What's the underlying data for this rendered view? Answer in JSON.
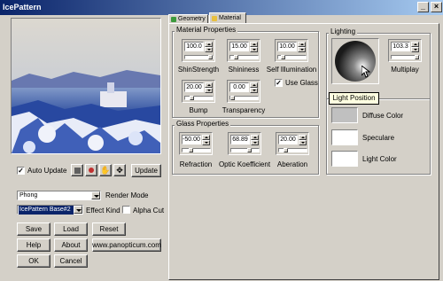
{
  "window": {
    "title": "IcePattern",
    "min_icon": "minimize-icon",
    "close_icon": "close-icon"
  },
  "preview": {
    "description_icon": "landscape-preview"
  },
  "auto_update": {
    "label": "Auto Update",
    "checked": true
  },
  "tools": {
    "icons": [
      "render-square-icon",
      "record-dot-icon",
      "hand-pan-icon",
      "move-arrows-icon"
    ],
    "update_label": "Update"
  },
  "render_mode": {
    "value": "Phong",
    "label": "Render Mode"
  },
  "effect_kind": {
    "value": "IcePattern Base#2",
    "label": "Effect Kind"
  },
  "alpha_cut": {
    "label": "Alpha Cut",
    "checked": false
  },
  "buttons": {
    "save": "Save",
    "load": "Load",
    "reset": "Reset",
    "help": "Help",
    "about": "About",
    "website": "www.panopticum.com",
    "ok": "OK",
    "cancel": "Cancel"
  },
  "tabs": [
    {
      "label": "Geometry",
      "active": false
    },
    {
      "label": "Material",
      "active": true
    }
  ],
  "material": {
    "title": "Material Properties",
    "shin_strength": {
      "value": "100.0",
      "label": "ShinStrength",
      "level": 1.0
    },
    "shininess": {
      "value": "15.00",
      "label": "Shininess",
      "level": 0.15
    },
    "self_illum": {
      "value": "10.00",
      "label": "Self Illumination",
      "level": 0.1
    },
    "bump": {
      "value": "20.00",
      "label": "Bump",
      "level": 0.2
    },
    "transparency": {
      "value": "0.00",
      "label": "Transparency",
      "level": 0.0
    },
    "use_glass": {
      "label": "Use Glass",
      "checked": true
    }
  },
  "glass": {
    "title": "Glass Properties",
    "refraction": {
      "value": "-50.00",
      "label": "Refraction",
      "level": 0.25
    },
    "optic_koef": {
      "value": "68.89",
      "label": "Optic Koefficient",
      "level": 0.69
    },
    "aberration": {
      "value": "20.00",
      "label": "Aberation",
      "level": 0.2
    }
  },
  "lighting": {
    "title": "Lighting",
    "multiplay": {
      "value": "103.3",
      "label": "Multiplay",
      "level": 1.0
    },
    "tooltip": "Light Position",
    "diffuse_label": "Diffuse Color",
    "diffuse_color": "#c0c0c0",
    "speculare_label": "Speculare",
    "speculare_color": "#ffffff",
    "light_color_label": "Light Color",
    "light_color": "#ffffff"
  }
}
